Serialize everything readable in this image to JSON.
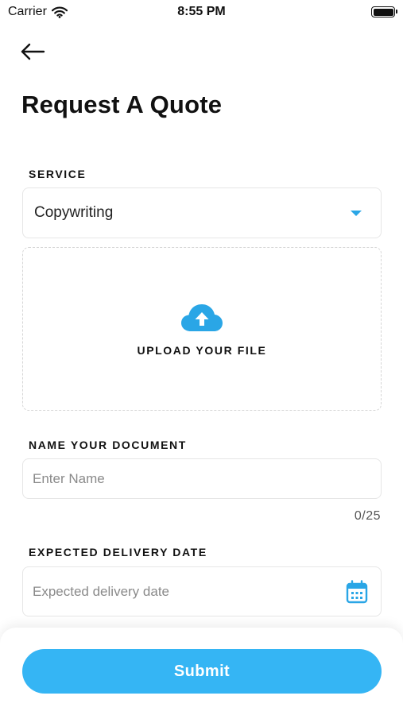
{
  "status_bar": {
    "carrier": "Carrier",
    "time": "8:55 PM",
    "icons": [
      "wifi-icon",
      "battery-icon"
    ]
  },
  "header": {
    "back_icon": "arrow-left-icon",
    "title": "Request A Quote"
  },
  "service": {
    "label": "SERVICE",
    "selected": "Copywriting",
    "icon": "caret-down-icon"
  },
  "upload": {
    "label": "UPLOAD YOUR FILE",
    "icon": "cloud-upload-icon"
  },
  "document_name": {
    "label": "NAME YOUR DOCUMENT",
    "value": "",
    "placeholder": "Enter Name",
    "counter": "0/25"
  },
  "delivery_date": {
    "label": "EXPECTED DELIVERY DATE",
    "value": "",
    "placeholder": "Expected delivery date",
    "icon": "calendar-icon"
  },
  "submit": {
    "label": "Submit"
  },
  "colors": {
    "accent": "#35b5f4",
    "icon_blue": "#2aa6e6",
    "text": "#111111",
    "placeholder": "#8a8a8a",
    "border": "#e6e6e6"
  }
}
